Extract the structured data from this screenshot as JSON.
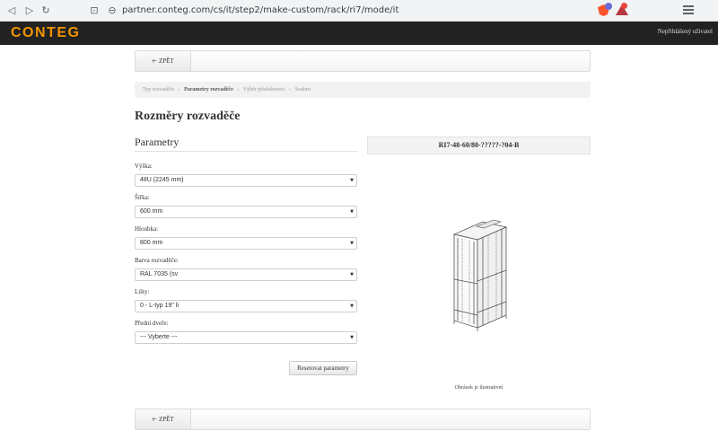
{
  "browser": {
    "url": "partner.conteg.com/cs/it/step2/make-custom/rack/ri7/mode/it",
    "icons": [
      "back-icon",
      "forward-icon",
      "reload-icon",
      "bookmark-icon",
      "lock-icon",
      "brave-shield-icon",
      "brave-rewards-icon",
      "menu-icon"
    ]
  },
  "header": {
    "logo": "CONTEG",
    "user": "Nepřihlášený uživatel",
    "logo_color": "#f29400",
    "bg_color": "#222222"
  },
  "nav": {
    "back_label": "ZPĚT"
  },
  "breadcrumb": {
    "items": [
      "Typ rozvaděče",
      "Parametry rozvaděče",
      "Výběr příslušenství",
      "Souhrn"
    ]
  },
  "page_title": "Rozměry rozvaděče",
  "section_title": "Parametry",
  "fields": [
    {
      "label": "Výška:",
      "value": "48U (2245 mm)"
    },
    {
      "label": "Šířka:",
      "value": "600 mm"
    },
    {
      "label": "Hloubka:",
      "value": "800 mm"
    },
    {
      "label": "Barva rozvaděče:",
      "value": "RAL 7035 (sv"
    },
    {
      "label": "Lišty:",
      "value": "0 - L-typ 19\" li"
    },
    {
      "label": "Přední dveře:",
      "value": "--- Vyberte ---"
    }
  ],
  "reset_label": "Resetovat parametry",
  "product_code": "RI7-48-60/80-?????-?04-B",
  "image_note": "Obrázek je ilustrativní"
}
